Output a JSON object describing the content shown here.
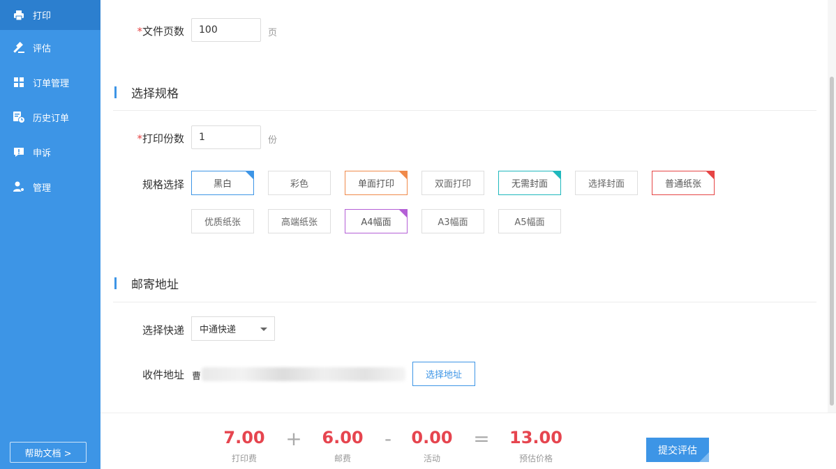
{
  "sidebar": {
    "items": [
      {
        "label": "打印",
        "icon": "printer-icon"
      },
      {
        "label": "评估",
        "icon": "gavel-icon"
      },
      {
        "label": "订单管理",
        "icon": "grid-icon"
      },
      {
        "label": "历史订单",
        "icon": "history-icon"
      },
      {
        "label": "申诉",
        "icon": "alert-icon"
      },
      {
        "label": "管理",
        "icon": "user-gear-icon"
      }
    ],
    "help_label": "帮助文档 >"
  },
  "form": {
    "pages": {
      "required_mark": "*",
      "label": "文件页数",
      "value": "100",
      "unit": "页"
    },
    "spec_section_title": "选择规格",
    "copies": {
      "required_mark": "*",
      "label": "打印份数",
      "value": "1",
      "unit": "份"
    },
    "spec_label": "规格选择",
    "spec_options": [
      {
        "label": "黑白",
        "selected": true,
        "color": "#3d95e6"
      },
      {
        "label": "彩色",
        "selected": false
      },
      {
        "label": "单面打印",
        "selected": true,
        "color": "#f08a4b"
      },
      {
        "label": "双面打印",
        "selected": false
      },
      {
        "label": "无需封面",
        "selected": true,
        "color": "#1fb8bd"
      },
      {
        "label": "选择封面",
        "selected": false
      },
      {
        "label": "普通纸张",
        "selected": true,
        "color": "#e64545"
      },
      {
        "label": "优质纸张",
        "selected": false
      },
      {
        "label": "高端纸张",
        "selected": false
      },
      {
        "label": "A4幅面",
        "selected": true,
        "color": "#b45fd6"
      },
      {
        "label": "A3幅面",
        "selected": false
      },
      {
        "label": "A5幅面",
        "selected": false
      }
    ],
    "mail_section_title": "邮寄地址",
    "courier": {
      "label": "选择快递",
      "value": "中通快递"
    },
    "address": {
      "label": "收件地址",
      "value_prefix": "曹",
      "button_label": "选择地址"
    }
  },
  "price": {
    "print_fee": {
      "value": "7.00",
      "label": "打印费"
    },
    "op_plus": "+",
    "postage": {
      "value": "6.00",
      "label": "邮费"
    },
    "op_minus": "-",
    "activity": {
      "value": "0.00",
      "label": "活动"
    },
    "op_equals": "=",
    "estimate": {
      "value": "13.00",
      "label": "预估价格"
    },
    "submit_label": "提交评估"
  },
  "colors": {
    "accent": "#3d95e6",
    "price": "#e6454f"
  }
}
